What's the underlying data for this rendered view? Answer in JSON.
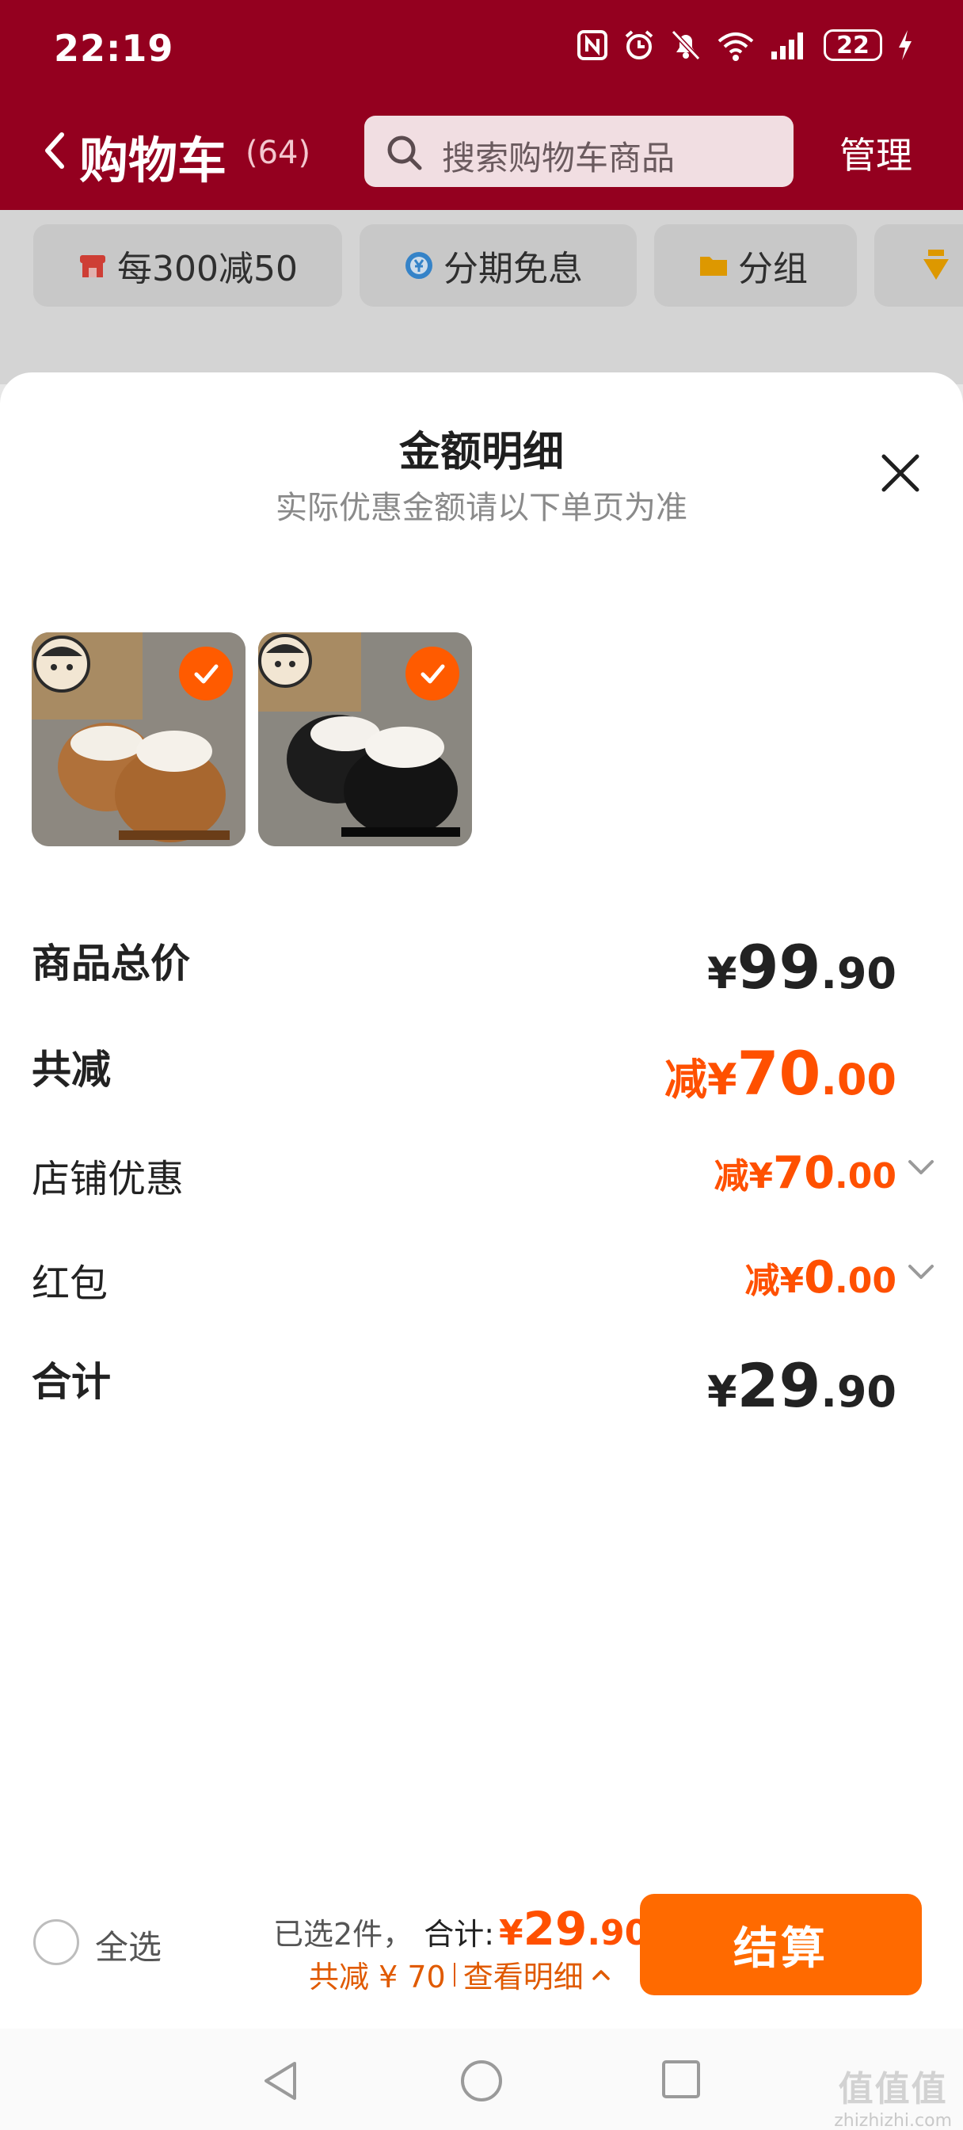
{
  "status_bar": {
    "time": "22:19",
    "battery": "22",
    "icons": [
      "nfc-icon",
      "alarm-icon",
      "mute-icon",
      "wifi-icon",
      "signal-icon",
      "battery-icon",
      "charging-icon"
    ]
  },
  "nav": {
    "title": "购物车",
    "count": "(64)",
    "search_placeholder": "搜索购物车商品",
    "manage_label": "管理"
  },
  "chips": [
    {
      "label": "每300减50",
      "icon": "store-icon"
    },
    {
      "label": "分期免息",
      "icon": "yen-circle-icon"
    },
    {
      "label": "分组",
      "icon": "folder-icon"
    }
  ],
  "sheet": {
    "title": "金额明细",
    "subtitle": "实际优惠金额请以下单页为准",
    "products": [
      {
        "name": "brown-slipper",
        "checked": true
      },
      {
        "name": "black-slipper",
        "checked": true
      }
    ],
    "rows": {
      "subtotal": {
        "label": "商品总价",
        "yen": "¥",
        "int": "99",
        "dec": ".90"
      },
      "discount_total": {
        "label": "共减",
        "prefix": "减¥",
        "int": "70",
        "dec": ".00"
      },
      "store_discount": {
        "label": "店铺优惠",
        "prefix": "减¥",
        "int": "70",
        "dec": ".00"
      },
      "red_packet": {
        "label": "红包",
        "prefix": "减¥",
        "int": "0",
        "dec": ".00"
      },
      "total": {
        "label": "合计",
        "yen": "¥",
        "int": "29",
        "dec": ".90"
      }
    }
  },
  "action_bar": {
    "select_all": "全选",
    "selected_count": "已选2件，",
    "total_label": "合计:",
    "total_yen": "¥",
    "total_int": "29",
    "total_dec": ".90",
    "saved_text": "共减 ¥ 70",
    "details_link": "查看明细",
    "checkout": "结算"
  },
  "watermark": {
    "big": "值值值",
    "small": "zhizhizhi.com"
  },
  "colors": {
    "header_bg": "#94001f",
    "accent_orange": "#ff5000",
    "checkout_bg": "#ff6a00"
  }
}
